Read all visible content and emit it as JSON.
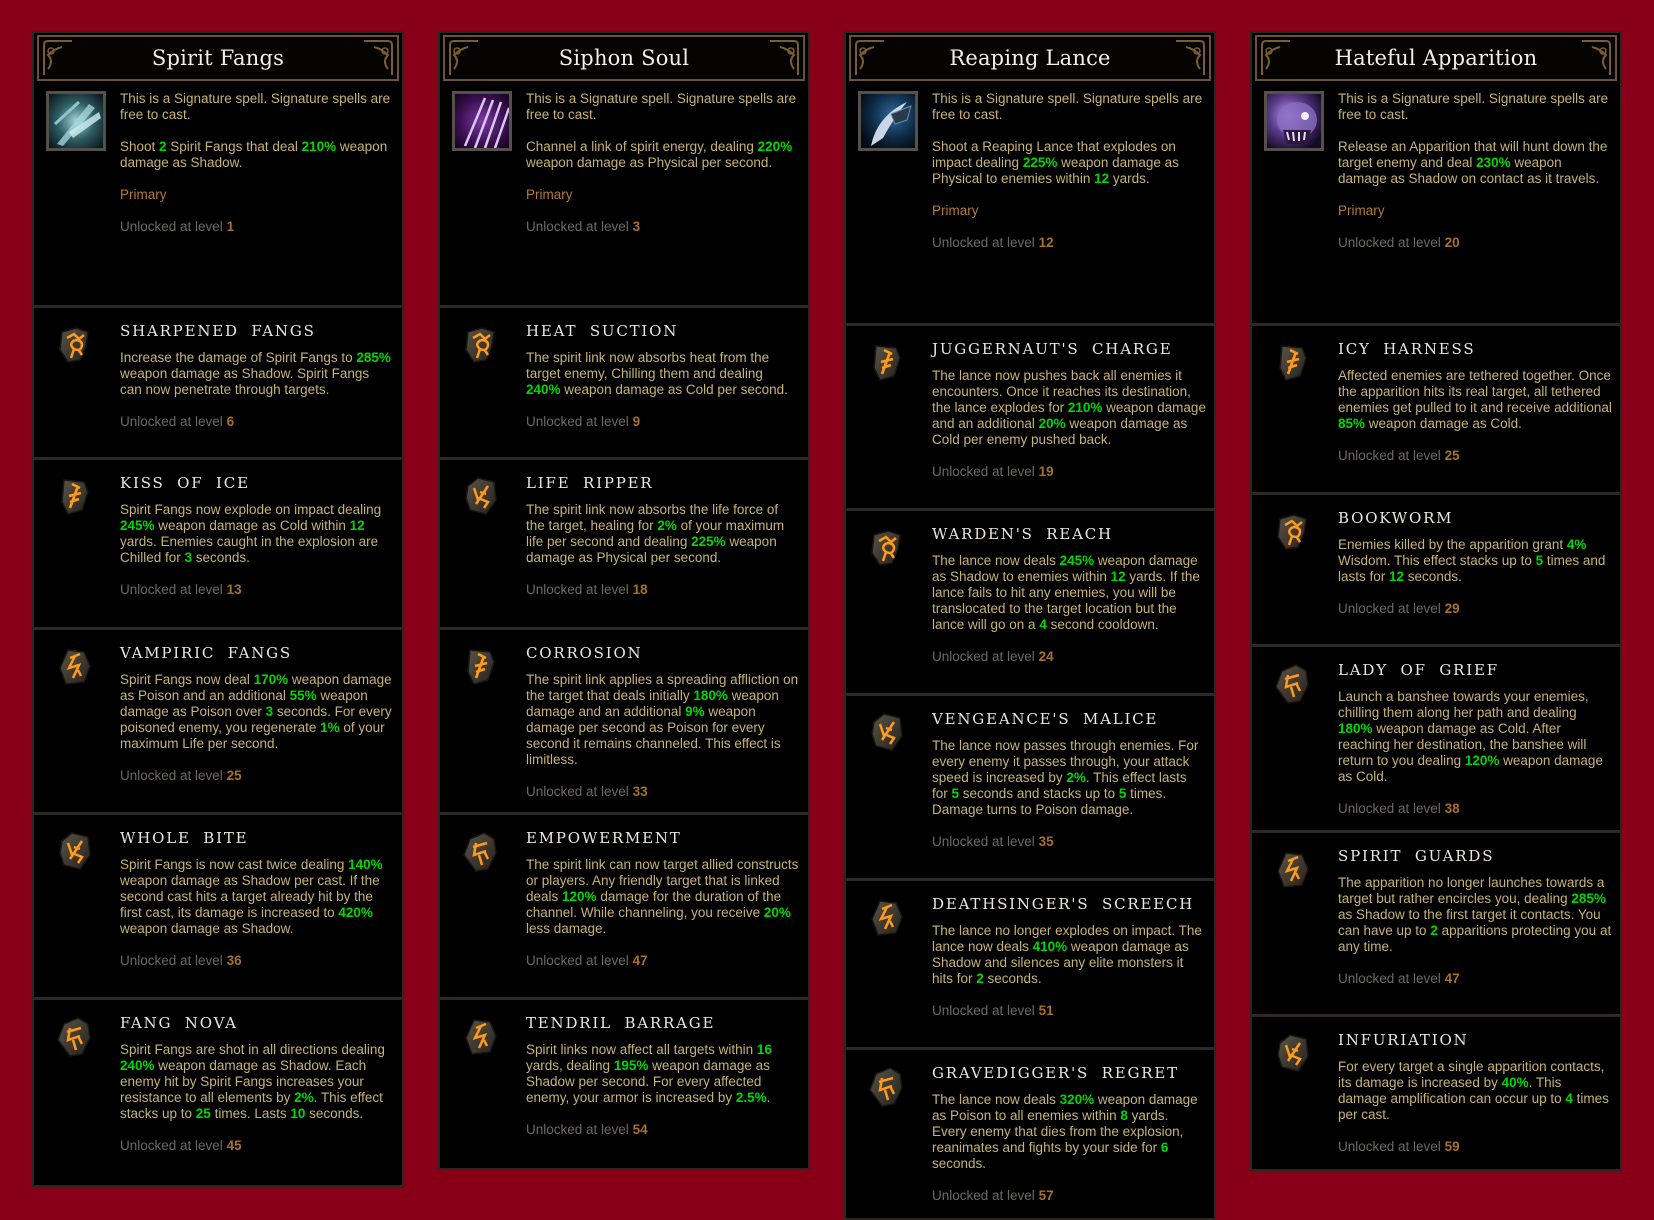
{
  "colors": {
    "background": "#870018",
    "panel": "#000000",
    "description_text": "#c7b377",
    "highlight_value": "#00d700",
    "category_text": "#b47a35",
    "unlock_text": "#6f6a60",
    "unlock_level": "#a8702c",
    "title_text": "#f4f0e6"
  },
  "unlock_prefix": "Unlocked at level ",
  "skills": [
    {
      "title": "Spirit Fangs",
      "icon": "spirit-fangs-icon",
      "signature_note": "This is a Signature spell. Signature spells are free to cast.",
      "description": [
        {
          "t": "Shoot "
        },
        {
          "v": "2"
        },
        {
          "t": " Spirit Fangs that deal "
        },
        {
          "v": "210%"
        },
        {
          "t": " weapon damage as Shadow."
        }
      ],
      "category": "Primary",
      "unlock_level": "1",
      "runes": [
        {
          "name": "Sharpened Fangs",
          "icon": "rune-crimson-icon",
          "description": [
            {
              "t": "Increase the damage of Spirit Fangs to "
            },
            {
              "v": "285%"
            },
            {
              "t": " weapon damage as Shadow. Spirit Fangs can now penetrate through targets."
            }
          ],
          "unlock_level": "6"
        },
        {
          "name": "Kiss of Ice",
          "icon": "rune-indigo-icon",
          "description": [
            {
              "t": "Spirit Fangs now explode on impact dealing "
            },
            {
              "v": "245%"
            },
            {
              "t": " weapon damage as Cold within "
            },
            {
              "v": "12"
            },
            {
              "t": " yards. Enemies caught in the explosion are Chilled for "
            },
            {
              "v": "3"
            },
            {
              "t": " seconds."
            }
          ],
          "unlock_level": "13"
        },
        {
          "name": "Vampiric Fangs",
          "icon": "rune-obsidian-icon",
          "description": [
            {
              "t": "Spirit Fangs now deal "
            },
            {
              "v": "170%"
            },
            {
              "t": " weapon damage as Poison and an additional "
            },
            {
              "v": "55%"
            },
            {
              "t": " weapon damage as Poison over "
            },
            {
              "v": "3"
            },
            {
              "t": " seconds. For every poisoned enemy, you regenerate "
            },
            {
              "v": "1%"
            },
            {
              "t": " of your maximum Life per second."
            }
          ],
          "unlock_level": "25"
        },
        {
          "name": "Whole Bite",
          "icon": "rune-golden-icon",
          "description": [
            {
              "t": "Spirit Fangs is now cast twice dealing "
            },
            {
              "v": "140%"
            },
            {
              "t": " weapon damage as Shadow per cast. If the second cast hits a target already hit by the first cast, its damage is increased to "
            },
            {
              "v": "420%"
            },
            {
              "t": " weapon damage as Shadow."
            }
          ],
          "unlock_level": "36"
        },
        {
          "name": "Fang Nova",
          "icon": "rune-alabaster-icon",
          "description": [
            {
              "t": "Spirit Fangs are shot in all directions dealing "
            },
            {
              "v": "240%"
            },
            {
              "t": " weapon damage as Shadow. Each enemy hit by Spirit Fangs increases your resistance to all elements by "
            },
            {
              "v": "2%"
            },
            {
              "t": ". This effect stacks up to "
            },
            {
              "v": "25"
            },
            {
              "t": " times. Lasts "
            },
            {
              "v": "10"
            },
            {
              "t": " seconds."
            }
          ],
          "unlock_level": "45"
        }
      ]
    },
    {
      "title": "Siphon Soul",
      "icon": "siphon-soul-icon",
      "signature_note": "This is a Signature spell. Signature spells are free to cast.",
      "description": [
        {
          "t": "Channel a link of spirit energy, dealing "
        },
        {
          "v": "220%"
        },
        {
          "t": " weapon damage as Physical per second."
        }
      ],
      "category": "Primary",
      "unlock_level": "3",
      "runes": [
        {
          "name": "Heat Suction",
          "icon": "rune-crimson-icon",
          "description": [
            {
              "t": "The spirit link now absorbs heat from the target enemy, Chilling them and dealing "
            },
            {
              "v": "240%"
            },
            {
              "t": " weapon damage as Cold per second."
            }
          ],
          "unlock_level": "9"
        },
        {
          "name": "Life Ripper",
          "icon": "rune-golden-icon",
          "description": [
            {
              "t": "The spirit link now absorbs the life force of the target, healing for "
            },
            {
              "v": "2%"
            },
            {
              "t": " of your maximum life per second and dealing "
            },
            {
              "v": "225%"
            },
            {
              "t": " weapon damage as Physical per second."
            }
          ],
          "unlock_level": "18"
        },
        {
          "name": "Corrosion",
          "icon": "rune-indigo-icon",
          "description": [
            {
              "t": "The spirit link applies a spreading affliction on the target that deals initially "
            },
            {
              "v": "180%"
            },
            {
              "t": " weapon damage and an additional "
            },
            {
              "v": "9%"
            },
            {
              "t": " weapon damage per second as Poison for every second it remains channeled. This effect is limitless."
            }
          ],
          "unlock_level": "33"
        },
        {
          "name": "Empowerment",
          "icon": "rune-alabaster-icon",
          "description": [
            {
              "t": "The spirit link can now target allied constructs or players. Any friendly target that is linked deals "
            },
            {
              "v": "120%"
            },
            {
              "t": " damage for the duration of the channel. While channeling, you receive "
            },
            {
              "v": "20%"
            },
            {
              "t": " less damage."
            }
          ],
          "unlock_level": "47"
        },
        {
          "name": "Tendril Barrage",
          "icon": "rune-obsidian-icon",
          "description": [
            {
              "t": "Spirit links now affect all targets within "
            },
            {
              "v": "16"
            },
            {
              "t": " yards, dealing "
            },
            {
              "v": "195%"
            },
            {
              "t": " weapon damage as Shadow per second. For every affected enemy, your armor is increased by "
            },
            {
              "v": "2.5%"
            },
            {
              "t": "."
            }
          ],
          "unlock_level": "54"
        }
      ]
    },
    {
      "title": "Reaping Lance",
      "icon": "reaping-lance-icon",
      "signature_note": "This is a Signature spell. Signature spells are free to cast.",
      "description": [
        {
          "t": "Shoot a Reaping Lance that explodes on impact dealing "
        },
        {
          "v": "225%"
        },
        {
          "t": " weapon damage as Physical to enemies within "
        },
        {
          "v": "12"
        },
        {
          "t": " yards."
        }
      ],
      "category": "Primary",
      "unlock_level": "12",
      "runes": [
        {
          "name": "Juggernaut's Charge",
          "icon": "rune-indigo-icon",
          "description": [
            {
              "t": "The lance now pushes back all enemies it encounters. Once it reaches its destination, the lance explodes for "
            },
            {
              "v": "210%"
            },
            {
              "t": " weapon damage and an additional "
            },
            {
              "v": "20%"
            },
            {
              "t": " weapon damage as Cold per enemy pushed back."
            }
          ],
          "unlock_level": "19"
        },
        {
          "name": "Warden's Reach",
          "icon": "rune-crimson-icon",
          "description": [
            {
              "t": "The lance now deals "
            },
            {
              "v": "245%"
            },
            {
              "t": " weapon damage as Shadow to enemies within "
            },
            {
              "v": "12"
            },
            {
              "t": " yards. If the lance fails to hit any enemies, you will be translocated to the target location but the lance will go on a "
            },
            {
              "v": "4"
            },
            {
              "t": " second cooldown."
            }
          ],
          "unlock_level": "24"
        },
        {
          "name": "Vengeance's Malice",
          "icon": "rune-golden-icon",
          "description": [
            {
              "t": "The lance now passes through enemies. For every enemy it passes through, your attack speed is increased by "
            },
            {
              "v": "2%"
            },
            {
              "t": ". This effect lasts for "
            },
            {
              "v": "5"
            },
            {
              "t": " seconds and stacks up to "
            },
            {
              "v": "5"
            },
            {
              "t": " times. Damage turns to Poison damage."
            }
          ],
          "unlock_level": "35"
        },
        {
          "name": "Deathsinger's Screech",
          "icon": "rune-obsidian-icon",
          "description": [
            {
              "t": "The lance no longer explodes on impact. The lance now deals "
            },
            {
              "v": "410%"
            },
            {
              "t": " weapon damage as Shadow and silences any elite monsters it hits for "
            },
            {
              "v": "2"
            },
            {
              "t": " seconds."
            }
          ],
          "unlock_level": "51"
        },
        {
          "name": "Gravedigger's Regret",
          "icon": "rune-alabaster-icon",
          "description": [
            {
              "t": "The lance now deals "
            },
            {
              "v": "320%"
            },
            {
              "t": " weapon damage as Poison to all enemies within "
            },
            {
              "v": "8"
            },
            {
              "t": " yards. Every enemy that dies from the explosion, reanimates and fights by your side for "
            },
            {
              "v": "6"
            },
            {
              "t": " seconds."
            }
          ],
          "unlock_level": "57"
        }
      ]
    },
    {
      "title": "Hateful Apparition",
      "icon": "hateful-apparition-icon",
      "signature_note": "This is a Signature spell. Signature spells are free to cast.",
      "description": [
        {
          "t": "Release an Apparition that will hunt down the target enemy and deal "
        },
        {
          "v": "230%"
        },
        {
          "t": " weapon damage as Shadow on contact as it travels."
        }
      ],
      "category": "Primary",
      "unlock_level": "20",
      "runes": [
        {
          "name": "Icy Harness",
          "icon": "rune-indigo-icon",
          "description": [
            {
              "t": "Affected enemies are tethered together. Once the apparition hits its real target, all tethered enemies get pulled to it and receive additional "
            },
            {
              "v": "85%"
            },
            {
              "t": " weapon damage as Cold."
            }
          ],
          "unlock_level": "25"
        },
        {
          "name": "Bookworm",
          "icon": "rune-crimson-icon",
          "description": [
            {
              "t": "Enemies killed by the apparition grant "
            },
            {
              "v": "4%"
            },
            {
              "t": " Wisdom. This effect stacks up to "
            },
            {
              "v": "5"
            },
            {
              "t": " times and lasts for "
            },
            {
              "v": "12"
            },
            {
              "t": " seconds."
            }
          ],
          "unlock_level": "29"
        },
        {
          "name": "Lady of Grief",
          "icon": "rune-alabaster-icon",
          "description": [
            {
              "t": "Launch a banshee towards your enemies, chilling them along her path and dealing "
            },
            {
              "v": "180%"
            },
            {
              "t": " weapon damage as Cold. After reaching her destination, the banshee will return to you dealing "
            },
            {
              "v": "120%"
            },
            {
              "t": " weapon damage as Cold."
            }
          ],
          "unlock_level": "38"
        },
        {
          "name": "Spirit Guards",
          "icon": "rune-obsidian-icon",
          "description": [
            {
              "t": "The apparition no longer launches towards a target but rather encircles you, dealing "
            },
            {
              "v": "285%"
            },
            {
              "t": " as Shadow to the first target it contacts. You can have up to "
            },
            {
              "v": "2"
            },
            {
              "t": " apparitions protecting you at any time."
            }
          ],
          "unlock_level": "47"
        },
        {
          "name": "Infuriation",
          "icon": "rune-golden-icon",
          "description": [
            {
              "t": "For every target a single apparition contacts, its damage is increased by "
            },
            {
              "v": "40%"
            },
            {
              "t": ". This damage amplification can occur up to "
            },
            {
              "v": "4"
            },
            {
              "t": " times per cast."
            }
          ],
          "unlock_level": "59"
        }
      ]
    }
  ]
}
